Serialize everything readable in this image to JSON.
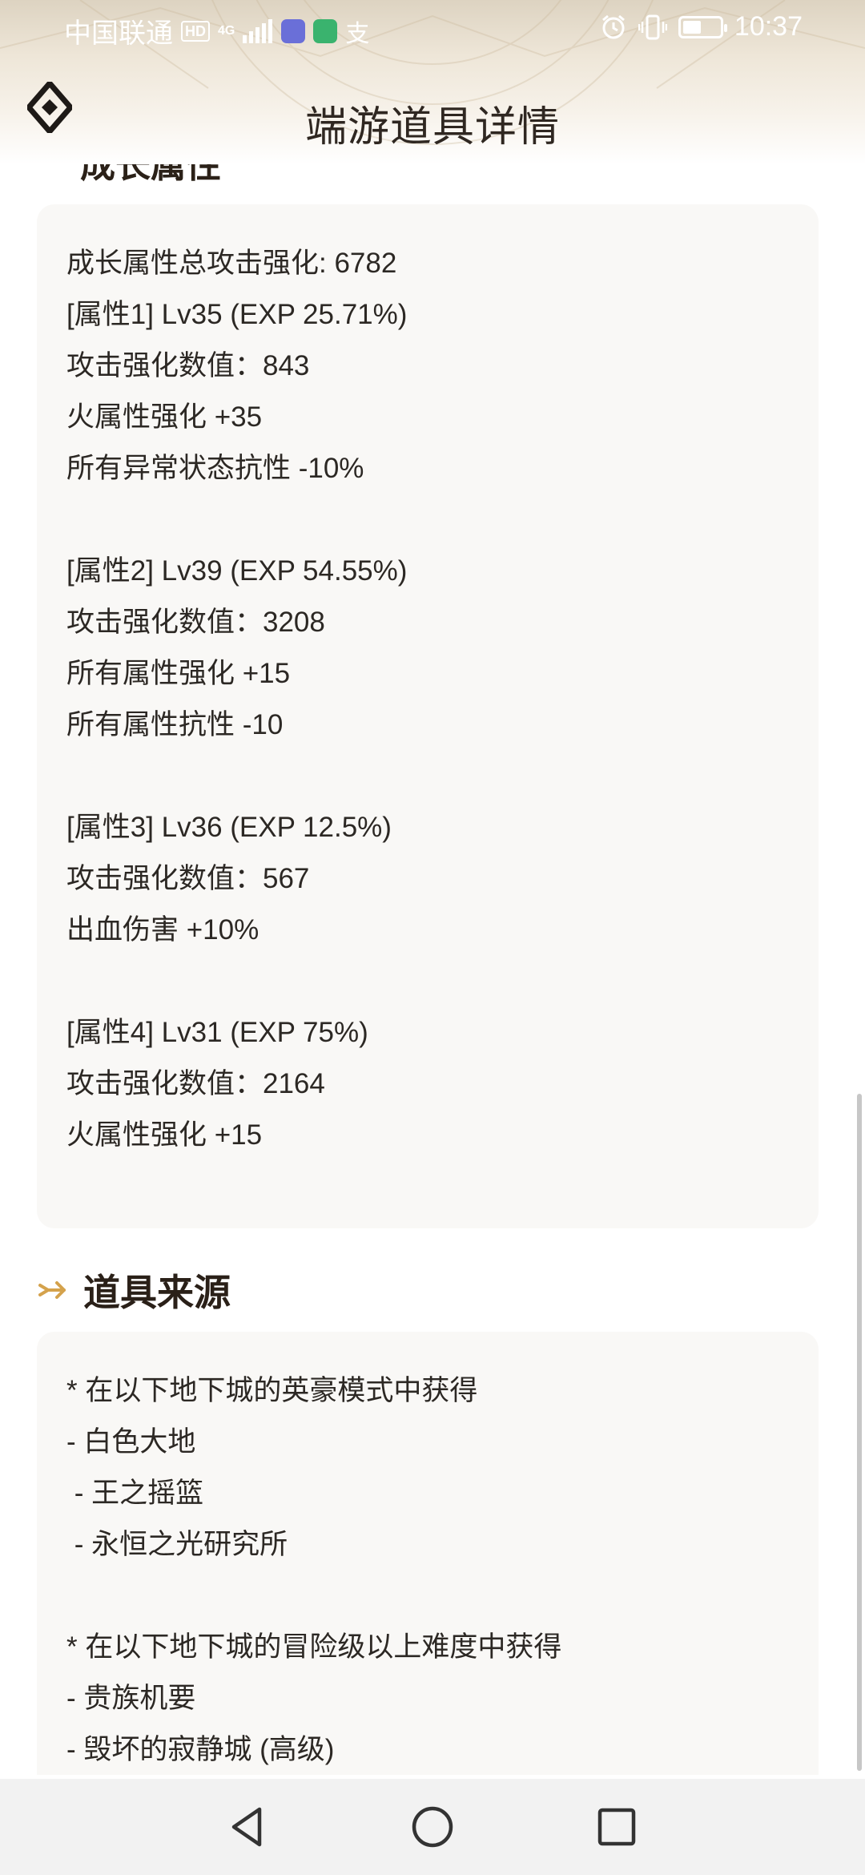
{
  "status_bar": {
    "carrier": "中国联通",
    "hd_badge": "HD",
    "network": "4G",
    "ime_char": "支",
    "time": "10:37",
    "icons": [
      "hd-icon",
      "signal-icon",
      "music-icon",
      "chat-icon",
      "alipay-icon",
      "alarm-icon",
      "vibrate-icon",
      "battery-icon"
    ]
  },
  "header": {
    "title": "端游道具详情"
  },
  "growth_section": {
    "title": "成长属性",
    "lines": [
      "成长属性总攻击强化: 6782",
      "[属性1] Lv35 (EXP 25.71%)",
      "攻击强化数值：843",
      "火属性强化 +35",
      "所有异常状态抗性 -10%",
      "[属性2] Lv39 (EXP 54.55%)",
      "攻击强化数值：3208",
      "所有属性强化 +15",
      "所有属性抗性 -10",
      "[属性3] Lv36 (EXP 12.5%)",
      "攻击强化数值：567",
      "出血伤害 +10%",
      "[属性4] Lv31 (EXP 75%)",
      "攻击强化数值：2164",
      "火属性强化 +15"
    ]
  },
  "source_section": {
    "title": "道具来源",
    "lines": [
      "* 在以下地下城的英豪模式中获得",
      "- 白色大地",
      " - 王之摇篮",
      " - 永恒之光研究所",
      "* 在以下地下城的冒险级以上难度中获得",
      "- 贵族机要",
      "- 毁坏的寂静城 (高级)"
    ]
  },
  "nav": {
    "back": "back-icon",
    "home": "home-icon",
    "recents": "recents-icon"
  },
  "colors": {
    "accent": "#d4a24c",
    "card_bg": "#f9f8f6",
    "text": "#2c2824"
  }
}
